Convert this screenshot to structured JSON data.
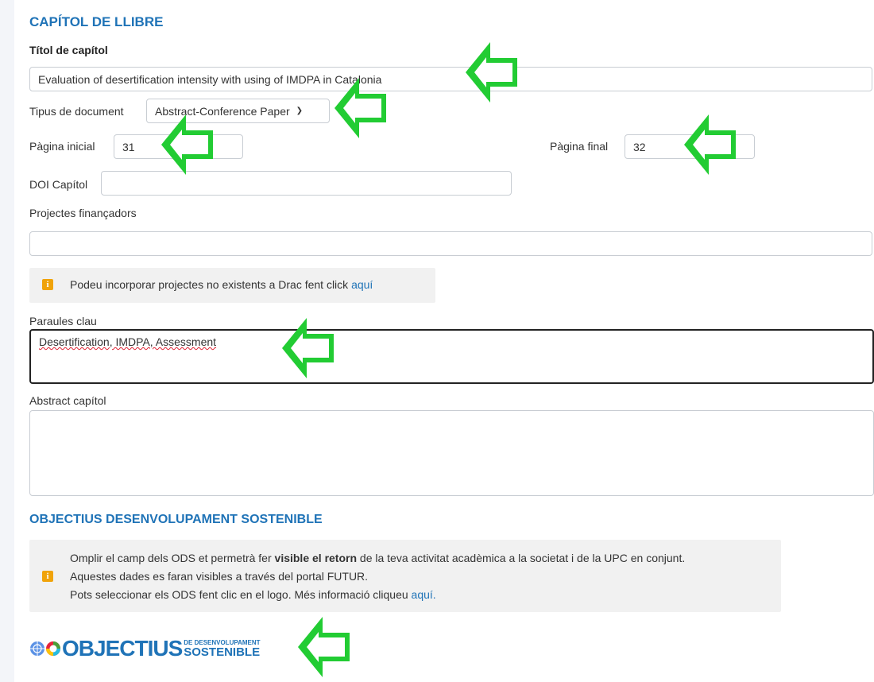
{
  "chapter": {
    "section_title": "CAPÍTOL DE LLIBRE",
    "title_label": "Títol de capítol",
    "title_value": "Evaluation of desertification intensity with using of IMDPA in Catalonia",
    "doc_type_label": "Tipus de document",
    "doc_type_value": "Abstract-Conference Paper",
    "page_start_label": "Pàgina inicial",
    "page_start_value": "31",
    "page_end_label": "Pàgina final",
    "page_end_value": "32",
    "doi_label": "DOI Capítol",
    "doi_value": "",
    "projects_label": "Projectes finançadors",
    "projects_value": "",
    "projects_info_text": "Podeu incorporar projectes no existents a Drac fent click ",
    "projects_info_link": "aquí",
    "keywords_label": "Paraules clau",
    "keywords_value": "Desertification, IMDPA, Assessment",
    "abstract_label": "Abstract capítol",
    "abstract_value": ""
  },
  "ods": {
    "section_title": "OBJECTIUS DESENVOLUPAMENT SOSTENIBLE",
    "info_line1_pre": "Omplir el camp dels ODS et permetrà fer ",
    "info_line1_bold": "visible el retorn",
    "info_line1_post": " de la teva activitat acadèmica a la societat i de la UPC en conjunt.",
    "info_line2": "Aquestes dades es faran visibles a través del portal FUTUR.",
    "info_line3_pre": "Pots seleccionar els ODS fent clic en el logo. Més informació cliqueu ",
    "info_line3_link": "aquí.",
    "logo_main": "OBJECTIUS",
    "logo_small_top": "DE DESENVOLUPAMENT",
    "logo_small_bottom": "SOSTENIBLE"
  },
  "colors": {
    "accent": "#1f73b7",
    "annotation_arrow": "#22cc33",
    "info_icon": "#f0a30a"
  }
}
